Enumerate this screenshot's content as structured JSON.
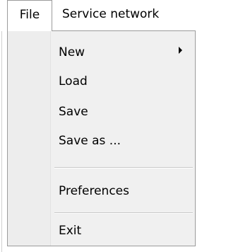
{
  "menubar": {
    "file_label": "File",
    "service_network_label": "Service network"
  },
  "file_menu": {
    "items": [
      {
        "label": "New",
        "has_submenu": true
      },
      {
        "label": "Load"
      },
      {
        "label": "Save"
      },
      {
        "label": "Save as ..."
      },
      {
        "label": "Preferences"
      },
      {
        "label": "Exit"
      }
    ],
    "submenu_icon": "triangle-right"
  }
}
